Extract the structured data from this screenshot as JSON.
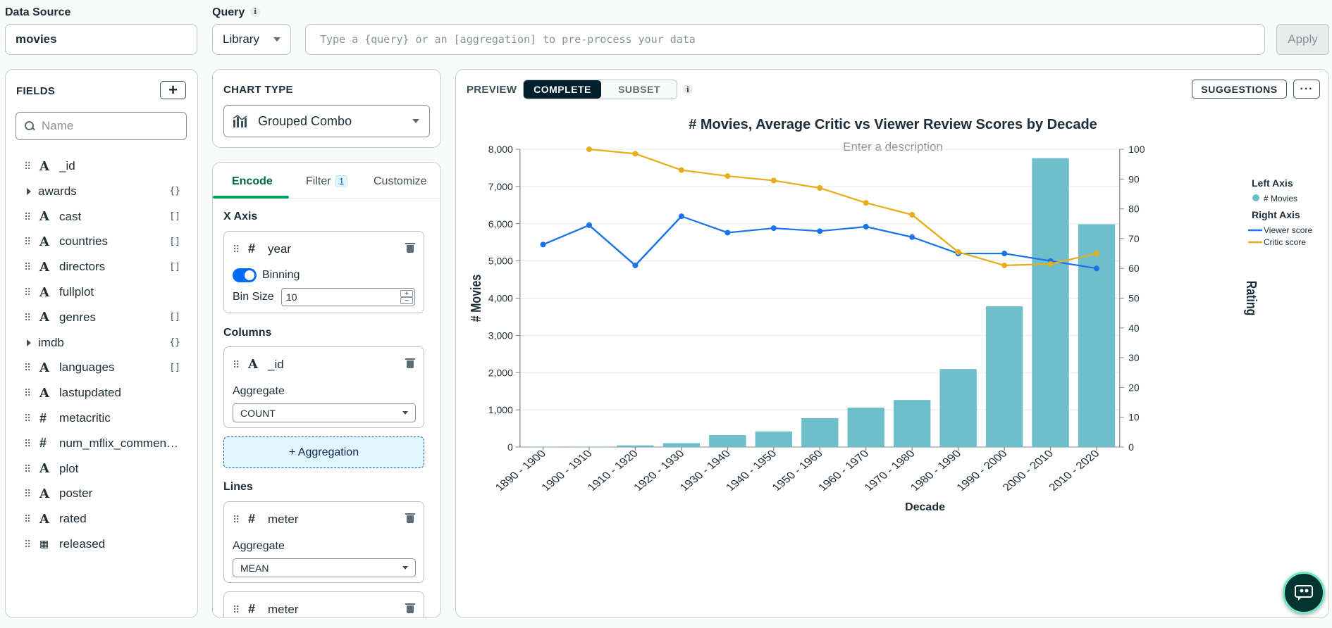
{
  "top": {
    "data_source_label": "Data Source",
    "data_source_value": "movies",
    "query_label": "Query",
    "query_mode": "Library",
    "query_placeholder": "Type a {query} or an [aggregation] to pre-process your data",
    "apply_label": "Apply"
  },
  "fields": {
    "title": "FIELDS",
    "search_placeholder": "Name",
    "items": [
      {
        "name": "_id",
        "kind": "string",
        "badge": ""
      },
      {
        "name": "awards",
        "kind": "object",
        "badge": "{}"
      },
      {
        "name": "cast",
        "kind": "string",
        "badge": "[]"
      },
      {
        "name": "countries",
        "kind": "string",
        "badge": "[]"
      },
      {
        "name": "directors",
        "kind": "string",
        "badge": "[]"
      },
      {
        "name": "fullplot",
        "kind": "string",
        "badge": ""
      },
      {
        "name": "genres",
        "kind": "string",
        "badge": "[]"
      },
      {
        "name": "imdb",
        "kind": "object",
        "badge": "{}"
      },
      {
        "name": "languages",
        "kind": "string",
        "badge": "[]"
      },
      {
        "name": "lastupdated",
        "kind": "string",
        "badge": ""
      },
      {
        "name": "metacritic",
        "kind": "number",
        "badge": ""
      },
      {
        "name": "num_mflix_commen…",
        "kind": "number",
        "badge": ""
      },
      {
        "name": "plot",
        "kind": "string",
        "badge": ""
      },
      {
        "name": "poster",
        "kind": "string",
        "badge": ""
      },
      {
        "name": "rated",
        "kind": "string",
        "badge": ""
      },
      {
        "name": "released",
        "kind": "date",
        "badge": ""
      }
    ]
  },
  "chart_type": {
    "title": "CHART TYPE",
    "selected": "Grouped Combo"
  },
  "encode": {
    "tabs": [
      "Encode",
      "Filter",
      "Customize"
    ],
    "filter_count": "1",
    "x_axis_label": "X Axis",
    "x_field": "year",
    "binning_label": "Binning",
    "bin_size_label": "Bin Size",
    "bin_size": "10",
    "columns_label": "Columns",
    "column_field": "_id",
    "aggregate_label": "Aggregate",
    "column_aggregate": "COUNT",
    "add_aggregation": "+ Aggregation",
    "lines_label": "Lines",
    "line1_field": "meter",
    "line1_aggregate": "MEAN",
    "line2_field": "meter"
  },
  "preview": {
    "label": "PREVIEW",
    "seg_complete": "COMPLETE",
    "seg_subset": "SUBSET",
    "suggestions": "SUGGESTIONS",
    "more": "···",
    "description_placeholder": "Enter a description"
  },
  "chart_data": {
    "type": "bar",
    "title": "# Movies, Average Critic vs Viewer Review Scores by Decade",
    "xlabel": "Decade",
    "ylabel": "# Movies",
    "y2label": "Rating",
    "categories": [
      "1890 - 1900",
      "1900 - 1910",
      "1910 - 1920",
      "1920 - 1930",
      "1930 - 1940",
      "1940 - 1950",
      "1950 - 1960",
      "1960 - 1970",
      "1970 - 1980",
      "1980 - 1990",
      "1990 - 2000",
      "2000 - 2010",
      "2010 - 2020"
    ],
    "ylim": [
      0,
      8000
    ],
    "yticks": [
      0,
      1000,
      2000,
      3000,
      4000,
      5000,
      6000,
      7000,
      8000
    ],
    "y2lim": [
      0,
      100
    ],
    "y2ticks": [
      0,
      10,
      20,
      30,
      40,
      50,
      60,
      70,
      80,
      90,
      100
    ],
    "grid": true,
    "legend": {
      "placement": "right",
      "left_title": "Left Axis",
      "right_title": "Right Axis"
    },
    "series": [
      {
        "name": "# Movies",
        "axis": "left",
        "kind": "bar",
        "color": "#6fbecb",
        "values": [
          3,
          8,
          45,
          105,
          320,
          420,
          775,
          1060,
          1265,
          2095,
          3780,
          7760,
          5985
        ]
      },
      {
        "name": "Viewer score",
        "axis": "right",
        "kind": "line",
        "color": "#1a73e8",
        "values": [
          68,
          74.5,
          61,
          77.5,
          72,
          73.5,
          72.5,
          74,
          70.5,
          65,
          65,
          62.5,
          60
        ]
      },
      {
        "name": "Critic score",
        "axis": "right",
        "kind": "line",
        "color": "#e6ad1d",
        "values": [
          null,
          100,
          98.5,
          93,
          91,
          89.5,
          87,
          82,
          78,
          65.5,
          61,
          61.5,
          65
        ]
      }
    ]
  },
  "colors": {
    "accent": "#00a35c",
    "toggle": "#016bf8",
    "bar": "#6fbecb",
    "viewer": "#1a73e8",
    "critic": "#e6ad1d"
  }
}
